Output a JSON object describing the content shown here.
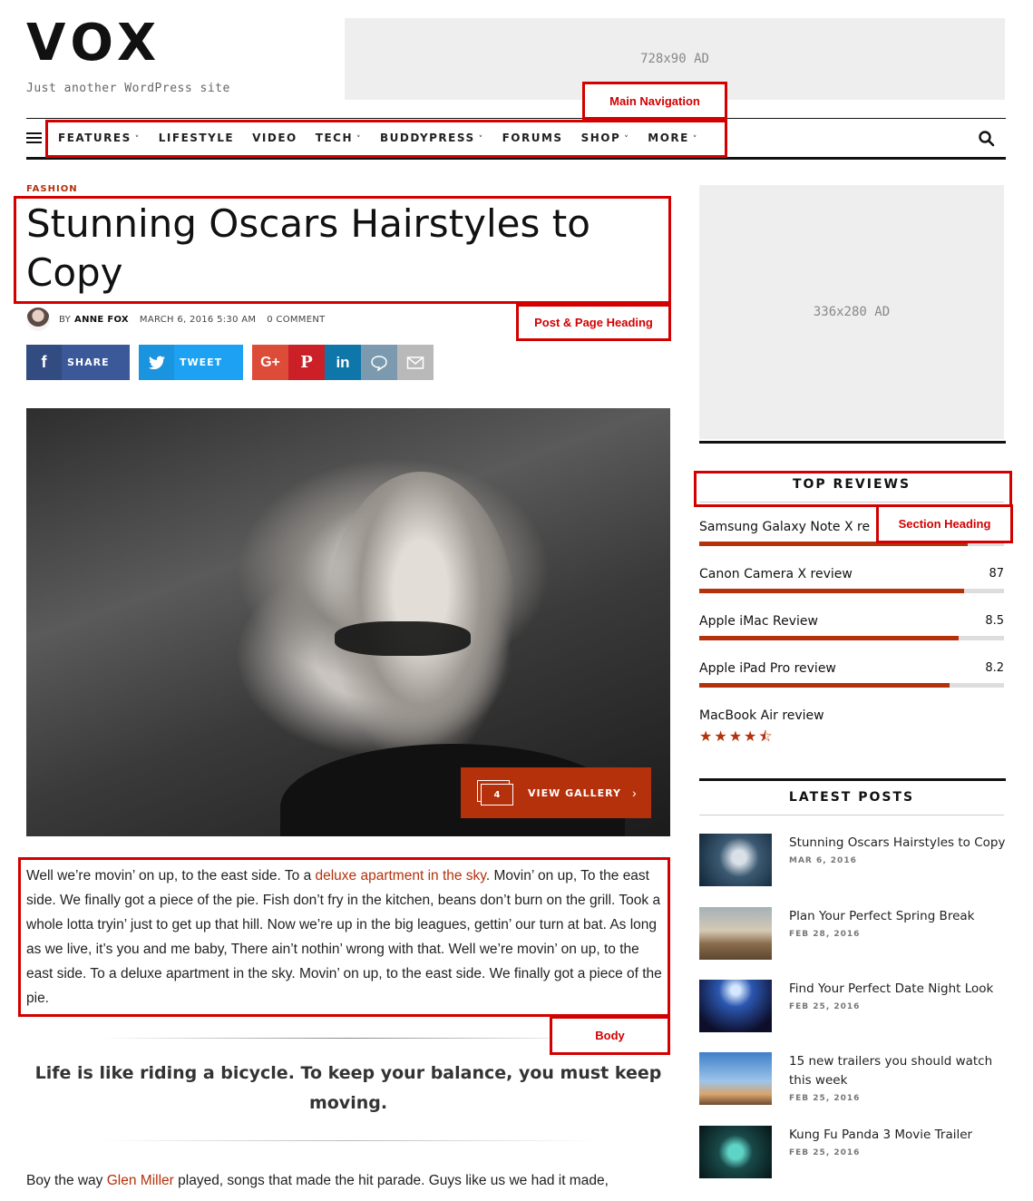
{
  "site": {
    "logo": "VOX",
    "tagline": "Just another WordPress site",
    "ad_top": "728x90 AD",
    "ad_side": "336x280 AD"
  },
  "nav": {
    "items": [
      {
        "label": "FEATURES",
        "has_dropdown": true
      },
      {
        "label": "LIFESTYLE",
        "has_dropdown": false
      },
      {
        "label": "VIDEO",
        "has_dropdown": false
      },
      {
        "label": "TECH",
        "has_dropdown": true
      },
      {
        "label": "BUDDYPRESS",
        "has_dropdown": true
      },
      {
        "label": "FORUMS",
        "has_dropdown": false
      },
      {
        "label": "SHOP",
        "has_dropdown": true
      },
      {
        "label": "MORE",
        "has_dropdown": true
      }
    ],
    "caret": "˅",
    "menu_icon": "hamburger-icon",
    "search_icon": "search-icon"
  },
  "annotations": {
    "main_navigation": "Main Navigation",
    "post_heading": "Post & Page Heading",
    "section_heading": "Section Heading",
    "body": "Body"
  },
  "article": {
    "category": "FASHION",
    "title": "Stunning Oscars Hairstyles to Copy",
    "meta": {
      "by": "BY",
      "author": "ANNE FOX",
      "date": "MARCH 6, 2016 5:30 AM",
      "comments": "0 COMMENT"
    },
    "share": {
      "facebook": "SHARE",
      "twitter": "TWEET",
      "facebook_glyph": "f",
      "googleplus_glyph": "G+",
      "pinterest_glyph": "P",
      "linkedin_glyph": "in"
    },
    "gallery": {
      "count": "4",
      "label": "VIEW GALLERY",
      "chevron": "›"
    },
    "body": {
      "p1_start": "Well we’re movin’ on up, to the east side. To a ",
      "p1_link": "deluxe apartment in the sky",
      "p1_end": ". Movin’ on up, To the east side. We finally got a piece of the pie. Fish don’t fry in the kitchen, beans don’t burn on the grill. Took a whole lotta tryin’ just to get up that hill. Now we’re up in the big leagues, gettin’ our turn at bat. As long as we live, it’s you and me baby, There ain’t nothin’ wrong with that. Well we’re movin’ on up, to the east side. To a deluxe apartment in the sky. Movin’ on up, to the east side. We finally got a piece of the pie.",
      "quote": "Life is like riding a bicycle. To keep your balance, you must keep moving.",
      "p2_start": "Boy the way ",
      "p2_link": "Glen Miller",
      "p2_end": " played, songs that made the hit parade. Guys like us we had it made,"
    }
  },
  "sidebar": {
    "top_reviews": {
      "title": "TOP REVIEWS",
      "items": [
        {
          "title": "Samsung Galaxy Note X re",
          "score": "",
          "fill": 0.88
        },
        {
          "title": "Canon Camera X review",
          "score": "87",
          "fill": 0.87
        },
        {
          "title": "Apple iMac Review",
          "score": "8.5",
          "fill": 0.85
        },
        {
          "title": "Apple iPad Pro review",
          "score": "8.2",
          "fill": 0.82
        },
        {
          "title": "MacBook Air review",
          "score": "",
          "stars": 4.5
        }
      ],
      "stars_text": "★★★★⯪"
    },
    "latest_posts": {
      "title": "LATEST POSTS",
      "items": [
        {
          "title": "Stunning Oscars Hairstyles to Copy",
          "date": "MAR 6, 2016"
        },
        {
          "title": "Plan Your Perfect Spring Break",
          "date": "FEB 28, 2016"
        },
        {
          "title": "Find Your Perfect Date Night Look",
          "date": "FEB 25, 2016"
        },
        {
          "title": "15 new trailers you should watch this week",
          "date": "FEB 25, 2016"
        },
        {
          "title": "Kung Fu Panda 3 Movie Trailer",
          "date": "FEB 25, 2016"
        }
      ]
    }
  },
  "colors": {
    "accent": "#b5310b",
    "annotation": "#d20000"
  }
}
